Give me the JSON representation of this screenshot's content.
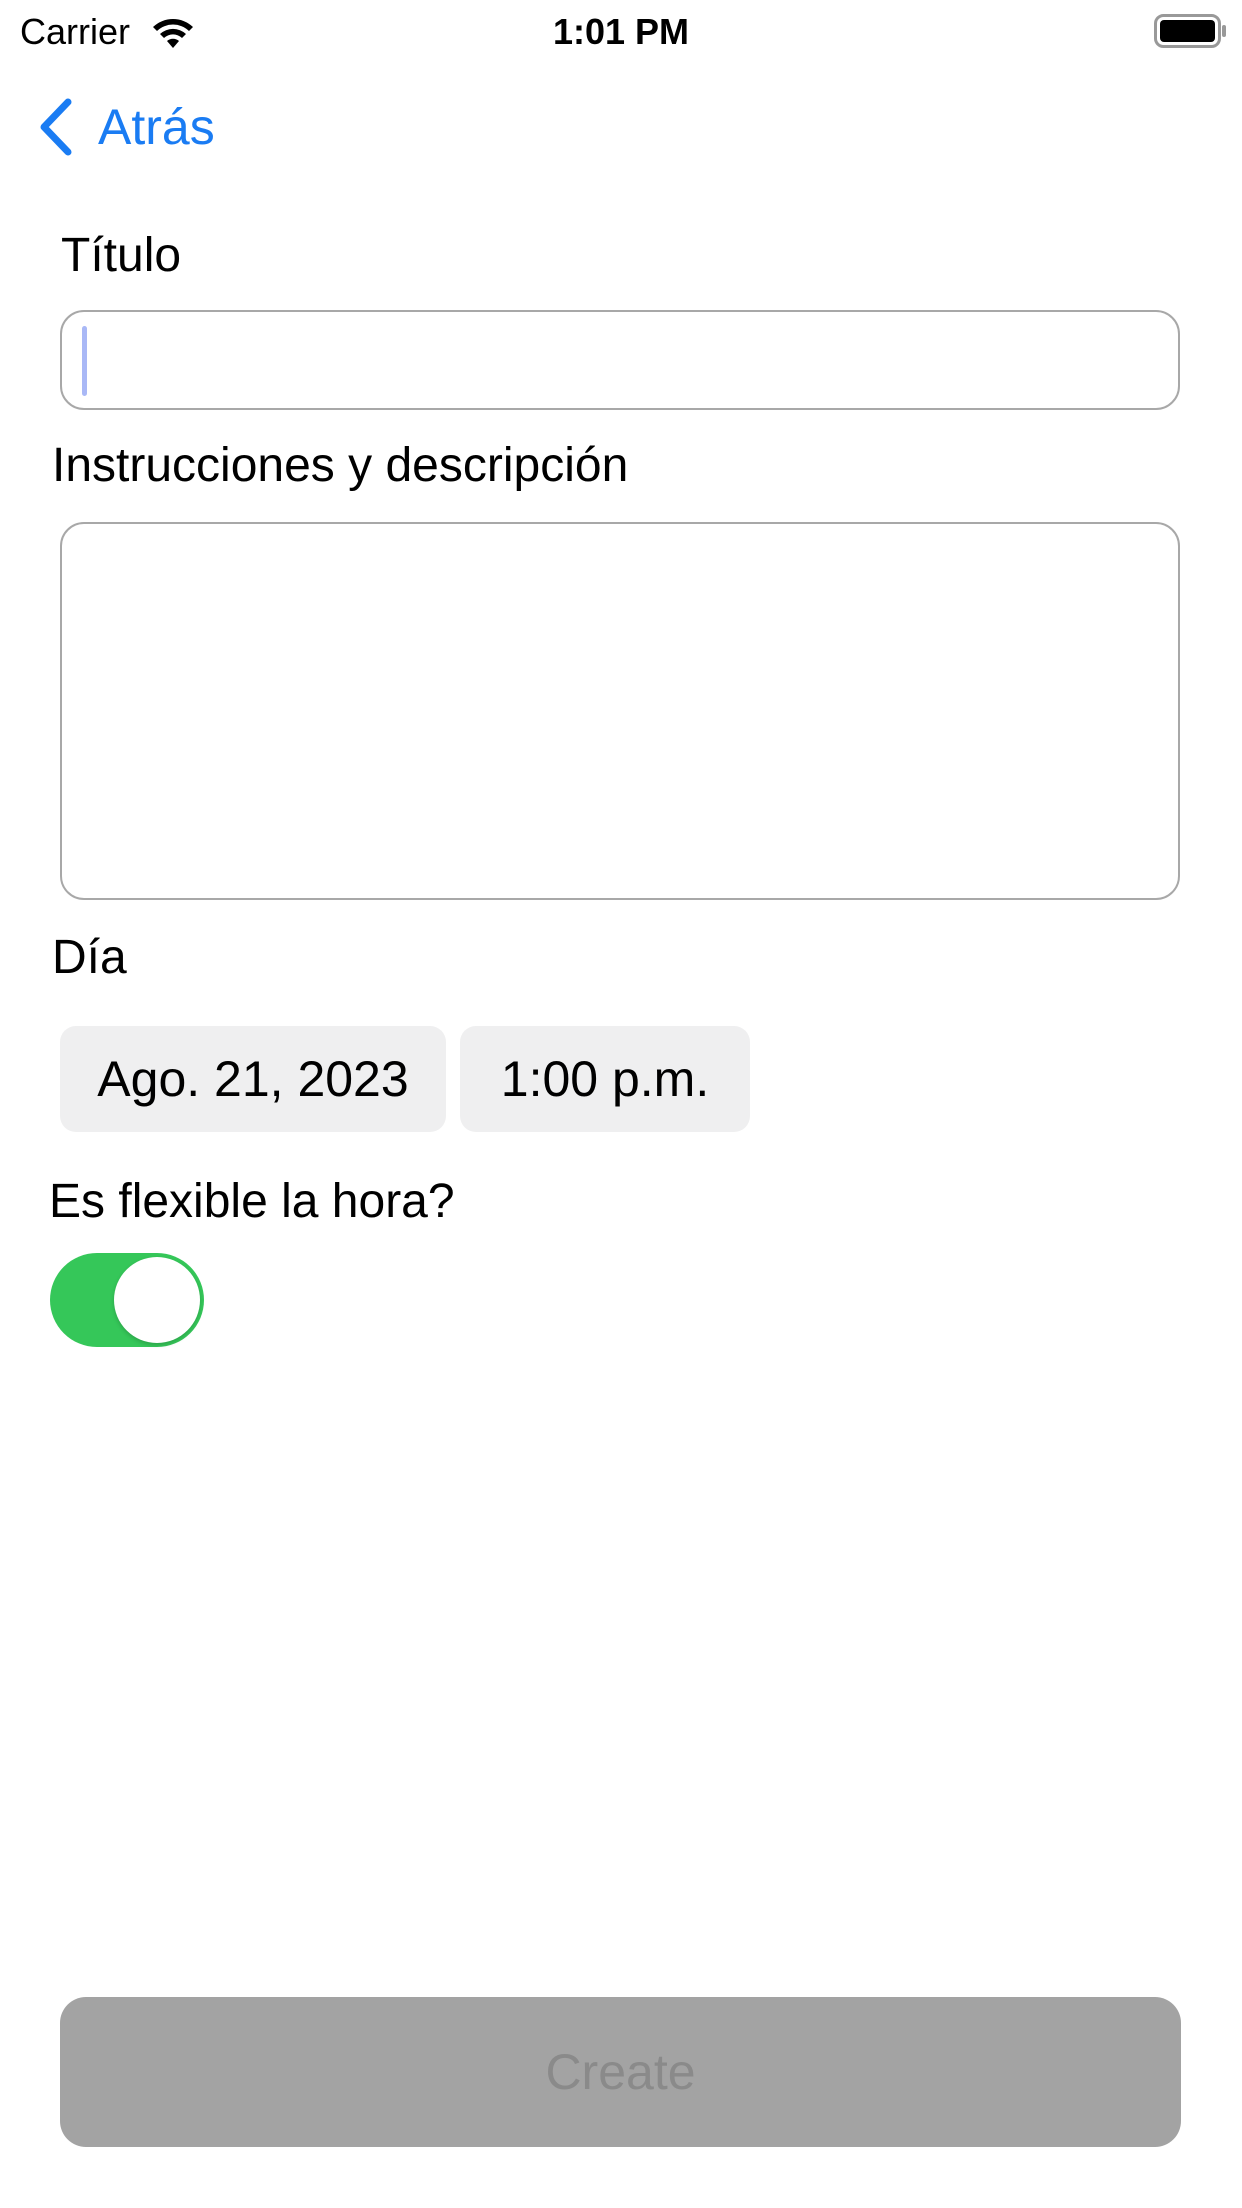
{
  "status_bar": {
    "carrier": "Carrier",
    "time": "1:01 PM",
    "wifi_icon": "wifi-icon",
    "battery_icon": "battery-icon"
  },
  "nav": {
    "back_label": "Atrás",
    "back_icon": "chevron-left-icon",
    "accent_color": "#1a7cf3"
  },
  "form": {
    "title_label": "Título",
    "title_value": "",
    "description_label": "Instrucciones y descripción",
    "description_value": "",
    "day_label": "Día",
    "date_value": "Ago. 21, 2023",
    "time_value": "1:00 p.m.",
    "flexible_label": "Es flexible la hora?",
    "flexible_on": true,
    "toggle_color": "#35c759"
  },
  "footer": {
    "create_label": "Create",
    "create_enabled": false
  }
}
